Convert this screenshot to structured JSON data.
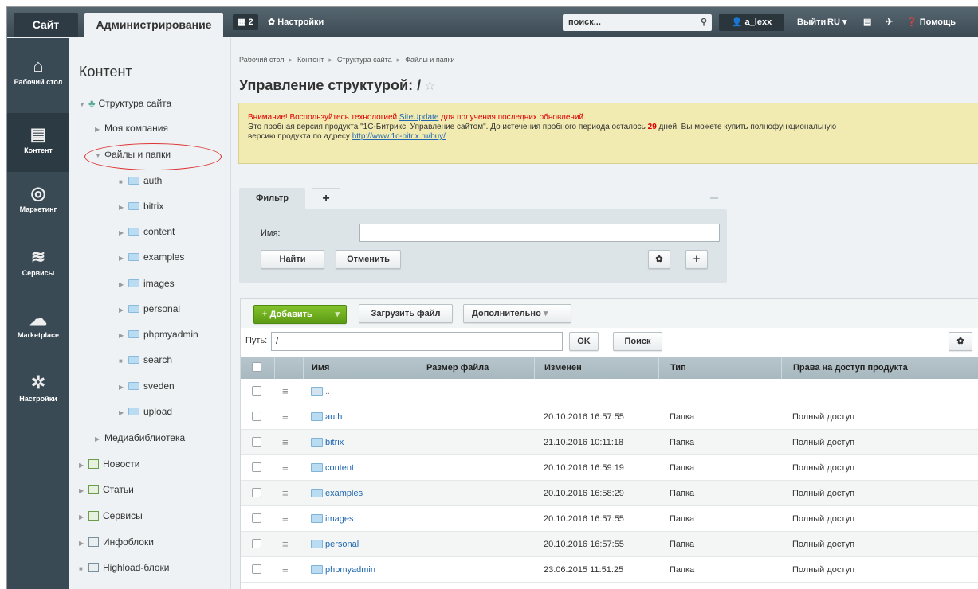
{
  "topbar": {
    "site_tab": "Сайт",
    "admin_tab": "Администрирование",
    "notif_count": "2",
    "settings": "Настройки",
    "search_placeholder": "поиск...",
    "user": "a_lexx",
    "logout": "Выйти",
    "lang": "RU",
    "help": "Помощь"
  },
  "leftbar": [
    {
      "icon": "home-icon",
      "label": "Рабочий стол"
    },
    {
      "icon": "document-icon",
      "label": "Контент"
    },
    {
      "icon": "target-icon",
      "label": "Маркетинг"
    },
    {
      "icon": "layers-icon",
      "label": "Сервисы"
    },
    {
      "icon": "cloud-download-icon",
      "label": "Marketplace"
    },
    {
      "icon": "gear-icon",
      "label": "Настройки"
    }
  ],
  "tree": {
    "title": "Контент",
    "items": [
      {
        "label": "Структура сайта"
      },
      {
        "label": "Моя компания"
      },
      {
        "label": "Файлы и папки"
      },
      {
        "label": "auth"
      },
      {
        "label": "bitrix"
      },
      {
        "label": "content"
      },
      {
        "label": "examples"
      },
      {
        "label": "images"
      },
      {
        "label": "personal"
      },
      {
        "label": "phpmyadmin"
      },
      {
        "label": "search"
      },
      {
        "label": "sveden"
      },
      {
        "label": "upload"
      },
      {
        "label": "Медиабиблиотека"
      },
      {
        "label": "Новости"
      },
      {
        "label": "Статьи"
      },
      {
        "label": "Сервисы"
      },
      {
        "label": "Инфоблоки"
      },
      {
        "label": "Highload-блоки"
      }
    ]
  },
  "breadcrumb": [
    "Рабочий стол",
    "Контент",
    "Структура сайта",
    "Файлы и папки"
  ],
  "page_title": "Управление структурой: /",
  "notice": {
    "line1_a": "Внимание! Воспользуйтесь технологией",
    "link1": "SiteUpdate",
    "line1_b": "для получения последних обновлений.",
    "line2_a": "Это пробная версия продукта \"1С-Битрикс: Управление сайтом\". До истечения пробного периода осталось",
    "days": "29",
    "line2_b": "дней. Вы можете купить полнофункциональную",
    "line3": "версию продукта по адресу",
    "link2": "http://www.1c-bitrix.ru/buy/"
  },
  "filter": {
    "tab": "Фильтр",
    "add_tab": "+",
    "name_label": "Имя:",
    "find": "Найти",
    "cancel": "Отменить"
  },
  "toolbar": {
    "add": "Добавить",
    "upload": "Загрузить файл",
    "more": "Дополнительно"
  },
  "pathbar": {
    "label": "Путь:",
    "value": "/",
    "ok": "OK",
    "search": "Поиск"
  },
  "table": {
    "columns": [
      "Имя",
      "Размер файла",
      "Изменен",
      "Тип",
      "Права на доступ продукта"
    ],
    "up_label": "..",
    "rows": [
      {
        "name": "auth",
        "modified": "20.10.2016 16:57:55",
        "type": "Папка",
        "rights": "Полный доступ"
      },
      {
        "name": "bitrix",
        "modified": "21.10.2016 10:11:18",
        "type": "Папка",
        "rights": "Полный доступ"
      },
      {
        "name": "content",
        "modified": "20.10.2016 16:59:19",
        "type": "Папка",
        "rights": "Полный доступ"
      },
      {
        "name": "examples",
        "modified": "20.10.2016 16:58:29",
        "type": "Папка",
        "rights": "Полный доступ"
      },
      {
        "name": "images",
        "modified": "20.10.2016 16:57:55",
        "type": "Папка",
        "rights": "Полный доступ"
      },
      {
        "name": "personal",
        "modified": "20.10.2016 16:57:55",
        "type": "Папка",
        "rights": "Полный доступ"
      },
      {
        "name": "phpmyadmin",
        "modified": "23.06.2015 11:51:25",
        "type": "Папка",
        "rights": "Полный доступ"
      }
    ]
  }
}
